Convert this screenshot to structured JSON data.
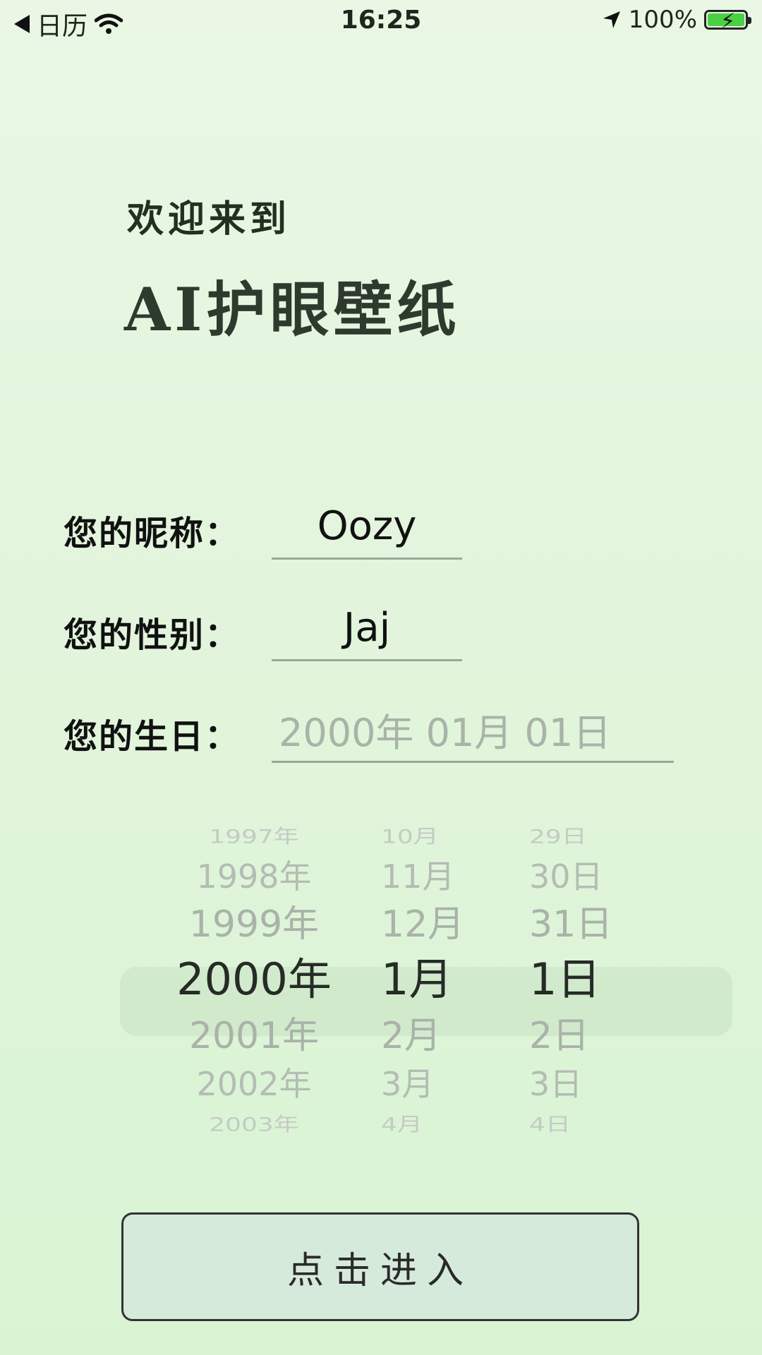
{
  "status_bar": {
    "back_app": "日历",
    "time": "16:25",
    "battery": "100%",
    "battery_level": 1.0,
    "icons": [
      "back-arrow-icon",
      "wifi-icon",
      "location-arrow-icon",
      "battery-charging-icon"
    ]
  },
  "welcome": {
    "greeting": "欢迎来到",
    "app_name": "AI护眼壁纸"
  },
  "form": {
    "nickname_label": "您的昵称：",
    "nickname_value": "Oozy",
    "gender_label": "您的性别：",
    "gender_value": "Jaj",
    "birthday_label": "您的生日：",
    "birthday_placeholder": "2000年 01月 01日"
  },
  "picker": {
    "years": [
      "1997年",
      "1998年",
      "1999年",
      "2000年",
      "2001年",
      "2002年",
      "2003年"
    ],
    "months": [
      "10月",
      "11月",
      "12月",
      "1月",
      "2月",
      "3月",
      "4月"
    ],
    "days": [
      "29日",
      "30日",
      "31日",
      "1日",
      "2日",
      "3日",
      "4日"
    ],
    "selected_index": 3
  },
  "enter_button": "点击进入",
  "colors": {
    "background": "#e2f5dc",
    "button_bg": "#d6eadc",
    "battery_fill": "#49d043"
  }
}
